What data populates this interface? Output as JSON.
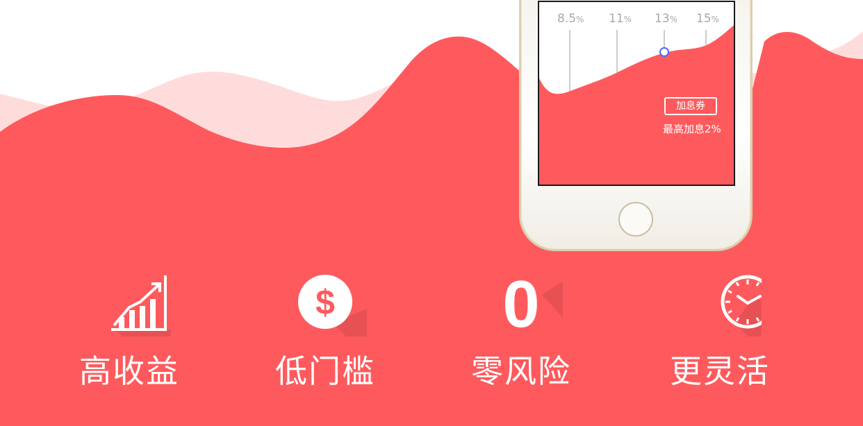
{
  "phone": {
    "rates": [
      {
        "num": "8.5",
        "unit": "%"
      },
      {
        "num": "11",
        "unit": "%"
      },
      {
        "num": "13",
        "unit": "%"
      },
      {
        "num": "15",
        "unit": "%"
      }
    ],
    "coupon_label": "加息券",
    "coupon_note": "最高加息2%"
  },
  "features": [
    {
      "label": "高收益",
      "icon": "growth-chart-icon"
    },
    {
      "label": "低门槛",
      "icon": "dollar-coin-icon"
    },
    {
      "label": "零风险",
      "icon": "zero-icon",
      "glyph": "0"
    },
    {
      "label": "更灵活",
      "icon": "clock-icon"
    }
  ],
  "colors": {
    "brand_red": "#fe5a5d",
    "light_pink": "#ffdcdc",
    "shadow": "#d94b4f"
  }
}
